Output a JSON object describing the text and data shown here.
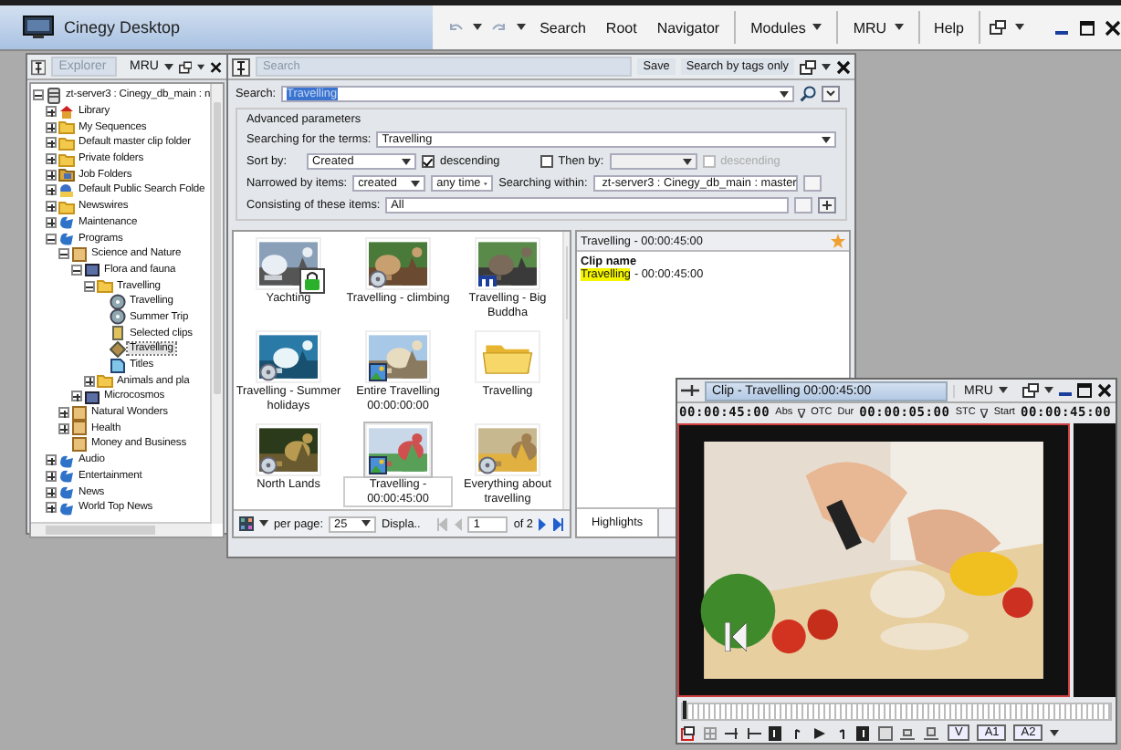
{
  "app": {
    "title": "Cinegy Desktop",
    "menu": [
      {
        "label": "Search",
        "dropdown": false
      },
      {
        "label": "Root",
        "dropdown": false
      },
      {
        "label": "Navigator",
        "dropdown": false
      },
      {
        "label": "Modules",
        "dropdown": true
      },
      {
        "label": "MRU",
        "dropdown": true
      },
      {
        "label": "Help",
        "dropdown": false
      }
    ]
  },
  "explorer": {
    "tab": "Explorer",
    "mru": "MRU",
    "tree": [
      {
        "label": "zt-server3 : Cinegy_db_main : n",
        "kind": "server",
        "expanded": true,
        "selected": false,
        "children": [
          {
            "label": "Library",
            "kind": "library",
            "expanded": false,
            "selected": false
          },
          {
            "label": "My Sequences",
            "kind": "folder",
            "expanded": false,
            "selected": false
          },
          {
            "label": "Default master clip folder",
            "kind": "folder",
            "expanded": false,
            "selected": false
          },
          {
            "label": "Private folders",
            "kind": "folder",
            "expanded": false,
            "selected": false
          },
          {
            "label": "Job Folders",
            "kind": "jobs",
            "expanded": false,
            "selected": false
          },
          {
            "label": "Default Public Search Folde",
            "kind": "search",
            "expanded": false,
            "selected": false
          },
          {
            "label": "Newswires",
            "kind": "folder",
            "expanded": false,
            "selected": false
          },
          {
            "label": "Maintenance",
            "kind": "program",
            "expanded": false,
            "selected": false
          },
          {
            "label": "Programs",
            "kind": "program",
            "expanded": true,
            "selected": false,
            "children": [
              {
                "label": "Science and Nature",
                "kind": "category",
                "expanded": true,
                "selected": false,
                "children": [
                  {
                    "label": "Flora and fauna",
                    "kind": "series",
                    "expanded": true,
                    "selected": false,
                    "children": [
                      {
                        "label": "Travelling",
                        "kind": "folder",
                        "expanded": true,
                        "selected": false,
                        "children": [
                          {
                            "label": "Travelling",
                            "kind": "reel",
                            "selected": false
                          },
                          {
                            "label": "Summer Trip",
                            "kind": "reel",
                            "selected": false
                          },
                          {
                            "label": "Selected clips",
                            "kind": "bin",
                            "selected": false
                          },
                          {
                            "label": "Travelling",
                            "kind": "sequence",
                            "selected": true
                          },
                          {
                            "label": "Titles",
                            "kind": "titles",
                            "selected": false
                          }
                        ]
                      },
                      {
                        "label": "Animals and pla",
                        "kind": "folder",
                        "expanded": false,
                        "selected": false
                      }
                    ]
                  },
                  {
                    "label": "Microcosmos",
                    "kind": "series",
                    "expanded": false,
                    "selected": false
                  }
                ]
              },
              {
                "label": "Natural Wonders",
                "kind": "category",
                "expanded": false,
                "selected": false
              },
              {
                "label": "Health",
                "kind": "category",
                "expanded": false,
                "selected": false
              },
              {
                "label": "Money and Business",
                "kind": "category",
                "selected": false
              }
            ]
          },
          {
            "label": "Audio",
            "kind": "program",
            "expanded": false,
            "selected": false
          },
          {
            "label": "Entertainment",
            "kind": "program",
            "expanded": false,
            "selected": false
          },
          {
            "label": "News",
            "kind": "program",
            "expanded": false,
            "selected": false
          },
          {
            "label": "World Top News",
            "kind": "program",
            "expanded": false,
            "selected": false
          }
        ]
      }
    ]
  },
  "search": {
    "title": "Search",
    "save": "Save",
    "tags_only": "Search by tags only",
    "query_label": "Search:",
    "query": "Travelling",
    "advanced_title": "Advanced parameters",
    "terms_label": "Searching for the terms:",
    "terms": "Travelling",
    "sort_label": "Sort by:",
    "sort": "Created",
    "sort_desc": {
      "label": "descending",
      "checked": true
    },
    "then_by": {
      "label": "Then by:",
      "checked": false
    },
    "then_desc": {
      "label": "descending",
      "checked": false,
      "disabled": true
    },
    "narrow_label": "Narrowed by items:",
    "narrow": "created",
    "time": "any time",
    "within_label": "Searching within:",
    "within": "zt-server3 : Cinegy_db_main : master",
    "consist_label": "Consisting of these items:",
    "consist": "All"
  },
  "results": {
    "items": [
      {
        "caption": "Yachting",
        "kind": "locked",
        "selected": false
      },
      {
        "caption": "Travelling - climbing",
        "kind": "clip",
        "selected": false
      },
      {
        "caption": "Travelling - Big Buddha",
        "kind": "title",
        "selected": false
      },
      {
        "caption": "Travelling - Summer holidays",
        "kind": "clip",
        "selected": false
      },
      {
        "caption": "Entire Travelling 00:00:00:00",
        "kind": "still",
        "selected": false
      },
      {
        "caption": "Travelling",
        "kind": "folder",
        "selected": false
      },
      {
        "caption": "North Lands",
        "kind": "clip",
        "selected": false
      },
      {
        "caption": "Travelling - 00:00:45:00",
        "kind": "still",
        "selected": true
      },
      {
        "caption": "Everything about travelling",
        "kind": "clip",
        "selected": false
      }
    ],
    "pager": {
      "per_page_label": "per page:",
      "per_page": "25",
      "display": "Displa..",
      "page": "1",
      "of": "of 2"
    }
  },
  "detail": {
    "title": "Travelling - 00:00:45:00",
    "field": "Clip name",
    "match": "Travelling",
    "rest": "- 00:00:45:00",
    "tabs": [
      {
        "label": "Highlights",
        "selected": true
      }
    ]
  },
  "clip": {
    "title": "Clip - Travelling 00:00:45:00",
    "mru": "MRU",
    "tc": "00:00:45:00",
    "tc_mode": "Abs",
    "otc": "OTC",
    "dur_label": "Dur",
    "dur": "00:00:05:00",
    "stc": "STC",
    "start_label": "Start",
    "start": "00:00:45:00",
    "timeline": {
      "level": 0.0
    },
    "tracks": [
      {
        "label": "V"
      },
      {
        "label": "A1"
      },
      {
        "label": "A2"
      }
    ]
  }
}
